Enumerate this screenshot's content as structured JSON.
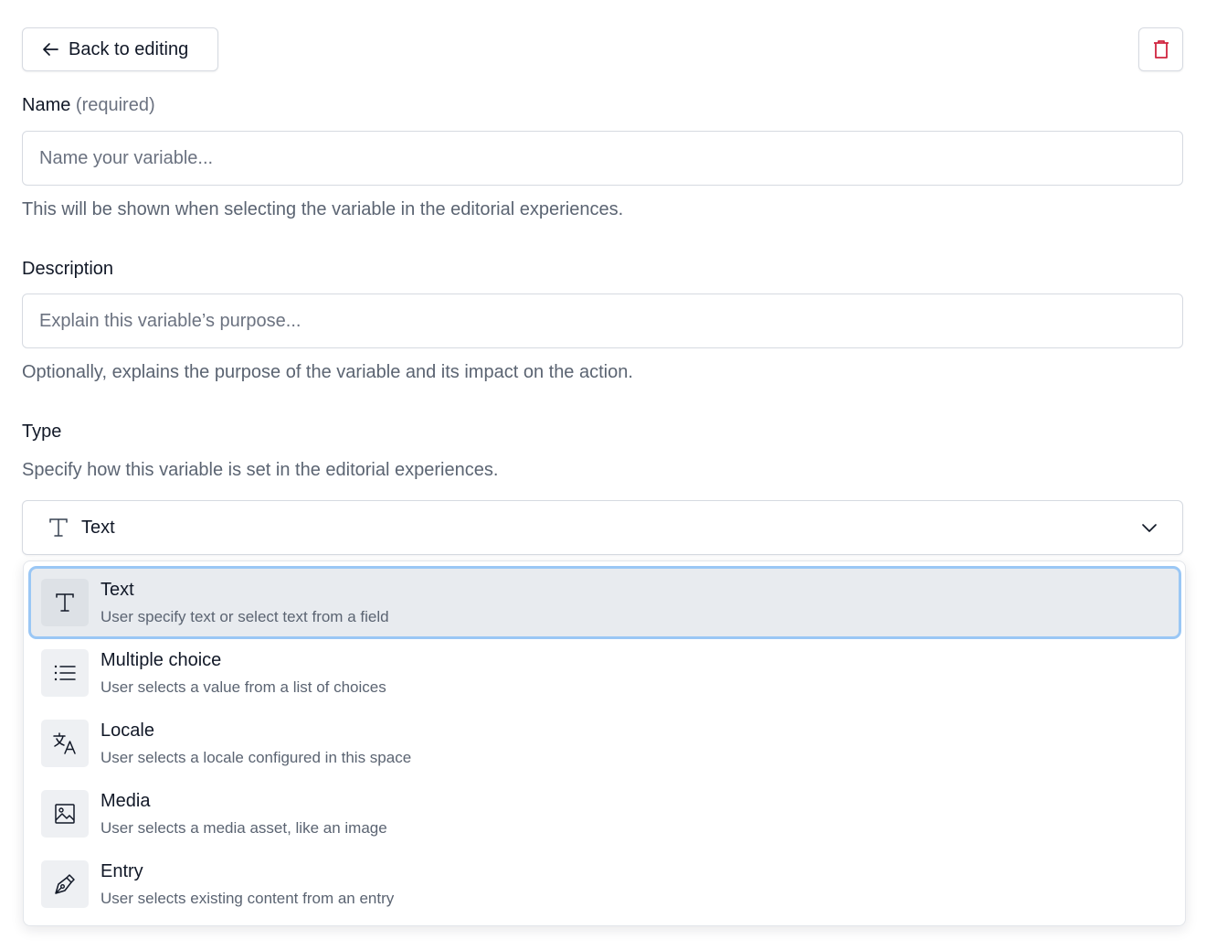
{
  "header": {
    "back_label": "Back to editing",
    "back_icon": "arrow-left-icon",
    "delete_icon": "trash-icon",
    "delete_color": "#d0243f"
  },
  "name_field": {
    "label": "Name",
    "required_hint": "(required)",
    "placeholder": "Name your variable...",
    "value": "",
    "help": "This will be shown when selecting the variable in the editorial experiences."
  },
  "description_field": {
    "label": "Description",
    "placeholder": "Explain this variable’s purpose...",
    "value": "",
    "help": "Optionally, explains the purpose of the variable and its impact on the action."
  },
  "type_field": {
    "label": "Type",
    "help": "Specify how this variable is set in the editorial experiences.",
    "selected_label": "Text",
    "selected_icon": "text-type-icon",
    "options": [
      {
        "title": "Text",
        "description": "User specify text or select text from a field",
        "icon": "text-type-icon",
        "selected": true
      },
      {
        "title": "Multiple choice",
        "description": "User selects a value from a list of choices",
        "icon": "list-icon",
        "selected": false
      },
      {
        "title": "Locale",
        "description": "User selects a locale configured in this space",
        "icon": "translate-icon",
        "selected": false
      },
      {
        "title": "Media",
        "description": "User selects a media asset, like an image",
        "icon": "image-icon",
        "selected": false
      },
      {
        "title": "Entry",
        "description": "User selects existing content from an entry",
        "icon": "pen-nib-icon",
        "selected": false
      }
    ]
  },
  "colors": {
    "focus_ring": "#9ac7f5",
    "selected_bg": "#e8ebef",
    "border": "#d6dae1"
  }
}
